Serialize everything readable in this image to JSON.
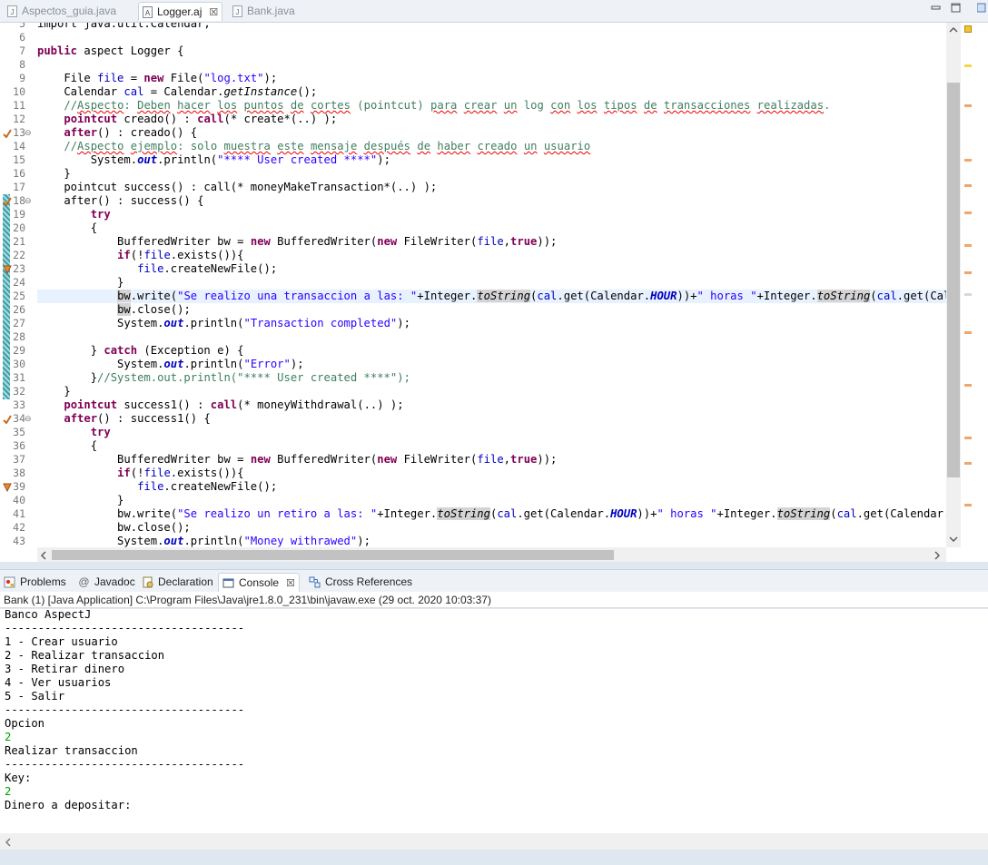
{
  "editor_tabs": [
    {
      "label": "Aspectos_guia.java",
      "icon": "java-file-icon",
      "active": false
    },
    {
      "label": "Logger.aj",
      "icon": "aspectj-file-icon",
      "active": true,
      "close": "☒"
    },
    {
      "label": "Bank.java",
      "icon": "java-file-icon",
      "active": false
    }
  ],
  "colors": {
    "keyword": "#7f0055",
    "string": "#2a00ff",
    "comment": "#3f7f5f",
    "field": "#0000c0",
    "console_input": "#00a000",
    "current_line": "#e8f2fe"
  },
  "code_lines": [
    {
      "n": "5",
      "html": "import java.util.Calendar;"
    },
    {
      "n": "6",
      "html": ""
    },
    {
      "n": "7",
      "html": "<span class=\"kw\">public</span> aspect Logger {"
    },
    {
      "n": "8",
      "html": ""
    },
    {
      "n": "9",
      "html": "    File <span class=\"fld\">file</span> = <span class=\"kw\">new</span> File(<span class=\"str\">\"log.txt\"</span>);"
    },
    {
      "n": "10",
      "html": "    Calendar <span class=\"fld\">cal</span> = Calendar.<span class=\"it\">getInstance</span>();"
    },
    {
      "n": "11",
      "html": "    <span class=\"cm\">//<span class=\"spell\">Aspecto</span>: <span class=\"spell\">Deben</span> <span class=\"spell\">hacer</span> <span class=\"spell\">los</span> <span class=\"spell\">puntos</span> <span class=\"spell\">de</span> <span class=\"spell\">cortes</span> (pointcut) <span class=\"spell\">para</span> <span class=\"spell\">crear</span> <span class=\"spell\">un</span> log <span class=\"spell\">con</span> <span class=\"spell\">los</span> <span class=\"spell\">tipos</span> <span class=\"spell\">de</span> <span class=\"spell\">transacciones</span> <span class=\"spell\">realizadas</span>.</span>"
    },
    {
      "n": "12",
      "html": "    <span class=\"kw\">pointcut</span> creado() : <span class=\"kw\">call</span>(* create*(..) );"
    },
    {
      "n": "13",
      "html": "    <span class=\"kw\">after</span>() : creado() {",
      "marker": "advice",
      "fold": true
    },
    {
      "n": "14",
      "html": "    <span class=\"cm\">//<span class=\"spell\">Aspecto</span> <span class=\"spell\">ejemplo</span>: solo <span class=\"spell\">muestra</span> <span class=\"spell\">este</span> <span class=\"spell\">mensaje</span> <span class=\"spell\">después</span> <span class=\"spell\">de</span> <span class=\"spell\">haber</span> <span class=\"spell\">creado</span> <span class=\"spell\">un</span> <span class=\"spell\">usuario</span></span>"
    },
    {
      "n": "15",
      "html": "        System.<span class=\"fld it\"><b>out</b></span>.println(<span class=\"str\">\"**** User created ****\"</span>);"
    },
    {
      "n": "16",
      "html": "    }"
    },
    {
      "n": "17",
      "html": "    pointcut success() : call(* moneyMakeTransaction*(..) );"
    },
    {
      "n": "18",
      "html": "    after() : success() {",
      "marker": "advice",
      "fold": true
    },
    {
      "n": "19",
      "html": "        <span class=\"kw\">try</span>"
    },
    {
      "n": "20",
      "html": "        {"
    },
    {
      "n": "21",
      "html": "            BufferedWriter bw = <span class=\"kw\">new</span> BufferedWriter(<span class=\"kw\">new</span> FileWriter(<span class=\"fld\">file</span>,<span class=\"kw\">true</span>));"
    },
    {
      "n": "22",
      "html": "            <span class=\"kw\">if</span>(!<span class=\"fld\">file</span>.exists()){"
    },
    {
      "n": "23",
      "html": "               <span class=\"fld\">file</span>.createNewFile();",
      "marker": "call"
    },
    {
      "n": "24",
      "html": "            }"
    },
    {
      "n": "25",
      "html": "            <span class=\"mk\">bw</span>.write(<span class=\"str\">\"Se realizo una transaccion a las: \"</span>+Integer.<span class=\"it mk\">toString</span>(<span class=\"fld\">cal</span>.get(Calendar.<span class=\"fld it\"><b>HOUR</b></span>))+<span class=\"str\">\" horas \"</span>+Integer.<span class=\"it mk\">toString</span>(<span class=\"fld\">cal</span>.get(Calendar.",
      "current": true
    },
    {
      "n": "26",
      "html": "            <span class=\"mk\">bw</span>.close();"
    },
    {
      "n": "27",
      "html": "            System.<span class=\"fld it\"><b>out</b></span>.println(<span class=\"str\">\"Transaction completed\"</span>);"
    },
    {
      "n": "28",
      "html": ""
    },
    {
      "n": "29",
      "html": "        } <span class=\"kw\">catch</span> (Exception e) {"
    },
    {
      "n": "30",
      "html": "            System.<span class=\"fld it\"><b>out</b></span>.println(<span class=\"str\">\"Error\"</span>);"
    },
    {
      "n": "31",
      "html": "        }<span class=\"cm\">//System.out.println(\"**** User created ****\");</span>"
    },
    {
      "n": "32",
      "html": "    }"
    },
    {
      "n": "33",
      "html": "    <span class=\"kw\">pointcut</span> success1() : <span class=\"kw\">call</span>(* moneyWithdrawal(..) );"
    },
    {
      "n": "34",
      "html": "    <span class=\"kw\">after</span>() : success1() {",
      "marker": "advice",
      "fold": true
    },
    {
      "n": "35",
      "html": "        <span class=\"kw\">try</span>"
    },
    {
      "n": "36",
      "html": "        {"
    },
    {
      "n": "37",
      "html": "            BufferedWriter bw = <span class=\"kw\">new</span> BufferedWriter(<span class=\"kw\">new</span> FileWriter(<span class=\"fld\">file</span>,<span class=\"kw\">true</span>));"
    },
    {
      "n": "38",
      "html": "            <span class=\"kw\">if</span>(!<span class=\"fld\">file</span>.exists()){"
    },
    {
      "n": "39",
      "html": "               <span class=\"fld\">file</span>.createNewFile();",
      "marker": "call"
    },
    {
      "n": "40",
      "html": "            }"
    },
    {
      "n": "41",
      "html": "            bw.write(<span class=\"str\">\"Se realizo un retiro a las: \"</span>+Integer.<span class=\"it mk\">toString</span>(<span class=\"fld\">cal</span>.get(Calendar.<span class=\"fld it\"><b>HOUR</b></span>))+<span class=\"str\">\" horas \"</span>+Integer.<span class=\"it mk\">toString</span>(<span class=\"fld\">cal</span>.get(Calendar.<span class=\"fld it\"><b>MINUTE</b></span>"
    },
    {
      "n": "42",
      "html": "            bw.close();"
    },
    {
      "n": "43",
      "html": "            System.<span class=\"fld it\"><b>out</b></span>.println(<span class=\"str\">\"Money withrawed\"</span>);"
    }
  ],
  "panel_tabs": [
    {
      "label": "Problems",
      "icon": "problems-icon",
      "active": false
    },
    {
      "label": "Javadoc",
      "icon": "javadoc-icon",
      "active": false
    },
    {
      "label": "Declaration",
      "icon": "declaration-icon",
      "active": false
    },
    {
      "label": "Console",
      "icon": "console-icon",
      "active": true,
      "close": "☒"
    },
    {
      "label": "Cross References",
      "icon": "cross-references-icon",
      "active": false
    }
  ],
  "console_header": "Bank (1) [Java Application] C:\\Program Files\\Java\\jre1.8.0_231\\bin\\javaw.exe (29 oct. 2020 10:03:37)",
  "console_lines": [
    {
      "text": "Banco AspectJ",
      "input": false
    },
    {
      "text": "------------------------------------",
      "input": false
    },
    {
      "text": "1 - Crear usuario",
      "input": false
    },
    {
      "text": "2 - Realizar transaccion",
      "input": false
    },
    {
      "text": "3 - Retirar dinero",
      "input": false
    },
    {
      "text": "4 - Ver usuarios",
      "input": false
    },
    {
      "text": "5 - Salir",
      "input": false
    },
    {
      "text": "------------------------------------",
      "input": false
    },
    {
      "text": "Opcion",
      "input": false
    },
    {
      "text": "2",
      "input": true
    },
    {
      "text": "Realizar transaccion",
      "input": false
    },
    {
      "text": "------------------------------------",
      "input": false
    },
    {
      "text": "Key:",
      "input": false
    },
    {
      "text": "2",
      "input": true
    },
    {
      "text": "Dinero a depositar:",
      "input": false
    }
  ]
}
